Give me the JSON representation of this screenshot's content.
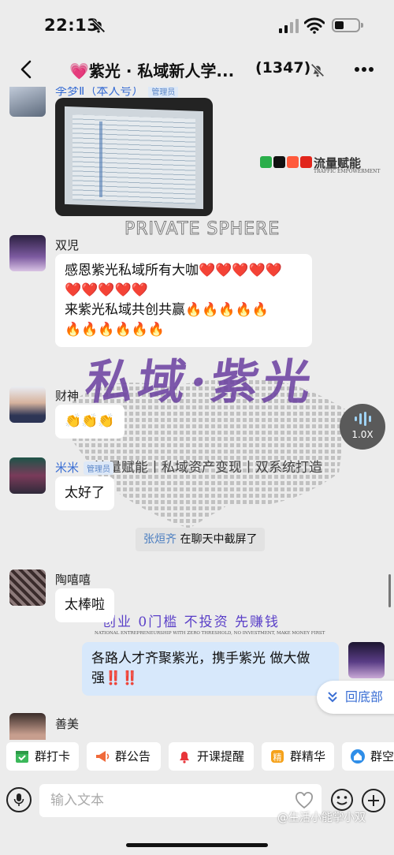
{
  "status_bar": {
    "time": "22:13"
  },
  "header": {
    "title": "💗紫光 · 私域新人学...",
    "member_count": "(1347)"
  },
  "watermarks": {
    "brand_cn": "流量赋能",
    "brand_en": "TRAFFIC EMPOWERMENT",
    "sphere": "PRIVATE SPHERE",
    "slogan_line": "流量赋能丨私域资产变现丨双系统打造",
    "tagline_cn": "创业 0门槛  不投资 先赚钱",
    "tagline_en": "NATIONAL ENTREPRENEURSHIP WITH ZERO THRESHOLD, NO INVESTMENT, MAKE MONEY FIRST"
  },
  "messages": {
    "m0": {
      "sender": "李梦Ⅱ（本人号）",
      "badge": "管理员"
    },
    "m1": {
      "sender": "双児",
      "lines": [
        "感恩紫光私域所有大咖❤️❤️❤️❤️❤️",
        "❤️❤️❤️❤️❤️",
        "来紫光私域共创共赢🔥🔥🔥🔥🔥",
        "🔥🔥🔥🔥🔥🔥"
      ]
    },
    "m2": {
      "sender": "财神",
      "text": "👏👏👏"
    },
    "m3": {
      "sender": "米米",
      "badge": "管理员",
      "text": "太好了"
    },
    "sys": {
      "who": "张烜齐",
      "action": " 在聊天中截屏了"
    },
    "m4": {
      "sender": "陶嘻嘻",
      "text": "太棒啦"
    },
    "m5": {
      "lines": [
        "各路人才齐聚紫光，携手紫光   做大做",
        "强‼️‼️"
      ]
    },
    "m6": {
      "sender": "善美"
    }
  },
  "audio_speed": "1.0X",
  "scroll_bottom_label": "回底部",
  "shortcuts": [
    "群打卡",
    "群公告",
    "开课提醒",
    "群精华",
    "群空"
  ],
  "input": {
    "placeholder": "输入文本"
  },
  "corner_watermark": "@生活小能掌小双",
  "colors": {
    "accent_blue": "#3b6fd4",
    "self_bubble": "#d7e8fb",
    "admin_badge": "#5a86c8"
  }
}
